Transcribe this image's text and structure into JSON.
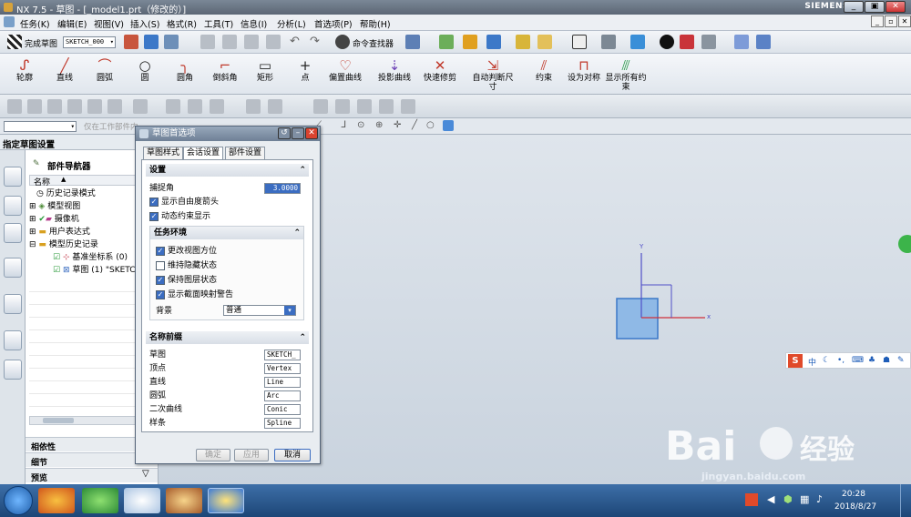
{
  "app": {
    "title": "NX 7.5 - 草图 - [_model1.prt（修改的）]",
    "brand": "SIEMENS"
  },
  "menu": [
    "任务(K)",
    "编辑(E)",
    "视图(V)",
    "插入(S)",
    "格式(R)",
    "工具(T)",
    "信息(I)",
    "分析(L)",
    "首选项(P)",
    "帮助(H)"
  ],
  "toolbar1": {
    "finish_sketch": "完成草图",
    "sketch_name": "SKETCH_000",
    "command_finder": "命令查找器"
  },
  "toolbar2": [
    "轮廓",
    "直线",
    "圆弧",
    "圆",
    "圆角",
    "倒斜角",
    "矩形",
    "点",
    "偏置曲线",
    "投影曲线",
    "快速修剪",
    "自动判断尺寸",
    "约束",
    "设为对称",
    "显示所有约束"
  ],
  "toolbar4_filter": "仅在工作部件内",
  "left_header": "指定草图设置",
  "navigator": {
    "title": "部件导航器",
    "column": "名称",
    "items": [
      "历史记录模式",
      "模型视图",
      "摄像机",
      "用户表达式",
      "模型历史记录",
      "基准坐标系 (0)",
      "草图 (1) \"SKETCH"
    ],
    "panels": [
      "相依性",
      "细节",
      "预览"
    ]
  },
  "dialog": {
    "title": "草图首选项",
    "tabs": [
      "草图样式",
      "会话设置",
      "部件设置"
    ],
    "settings_header": "设置",
    "snap_angle_label": "捕捉角",
    "snap_angle_value": "3.0000",
    "checks": [
      {
        "label": "显示自由度箭头",
        "checked": true
      },
      {
        "label": "动态约束显示",
        "checked": true
      }
    ],
    "task_env_header": "任务环境",
    "task_checks": [
      {
        "label": "更改视图方位",
        "checked": true
      },
      {
        "label": "维持隐藏状态",
        "checked": false
      },
      {
        "label": "保持图层状态",
        "checked": true
      },
      {
        "label": "显示截面映射警告",
        "checked": true
      }
    ],
    "background_label": "背景",
    "background_value": "普通",
    "prefix_header": "名称前缀",
    "prefixes": [
      {
        "label": "草图",
        "value": "SKETCH_"
      },
      {
        "label": "顶点",
        "value": "Vertex"
      },
      {
        "label": "直线",
        "value": "Line"
      },
      {
        "label": "圆弧",
        "value": "Arc"
      },
      {
        "label": "二次曲线",
        "value": "Conic"
      },
      {
        "label": "样条",
        "value": "Spline"
      }
    ],
    "buttons": [
      "确定",
      "应用",
      "取消"
    ]
  },
  "viewport": {
    "axis_x": "x",
    "axis_y": "Y"
  },
  "ime": {
    "logo": "S",
    "mode": "中"
  },
  "watermark": {
    "brand": "Bai",
    "site": "jingyan.baidu.com",
    "cn": "经验"
  },
  "taskbar": {
    "time": "20:28",
    "date": "2018/8/27"
  },
  "colors": {
    "accent": "#3b6dc1",
    "close": "#d9432f",
    "title": "#6f8096"
  }
}
